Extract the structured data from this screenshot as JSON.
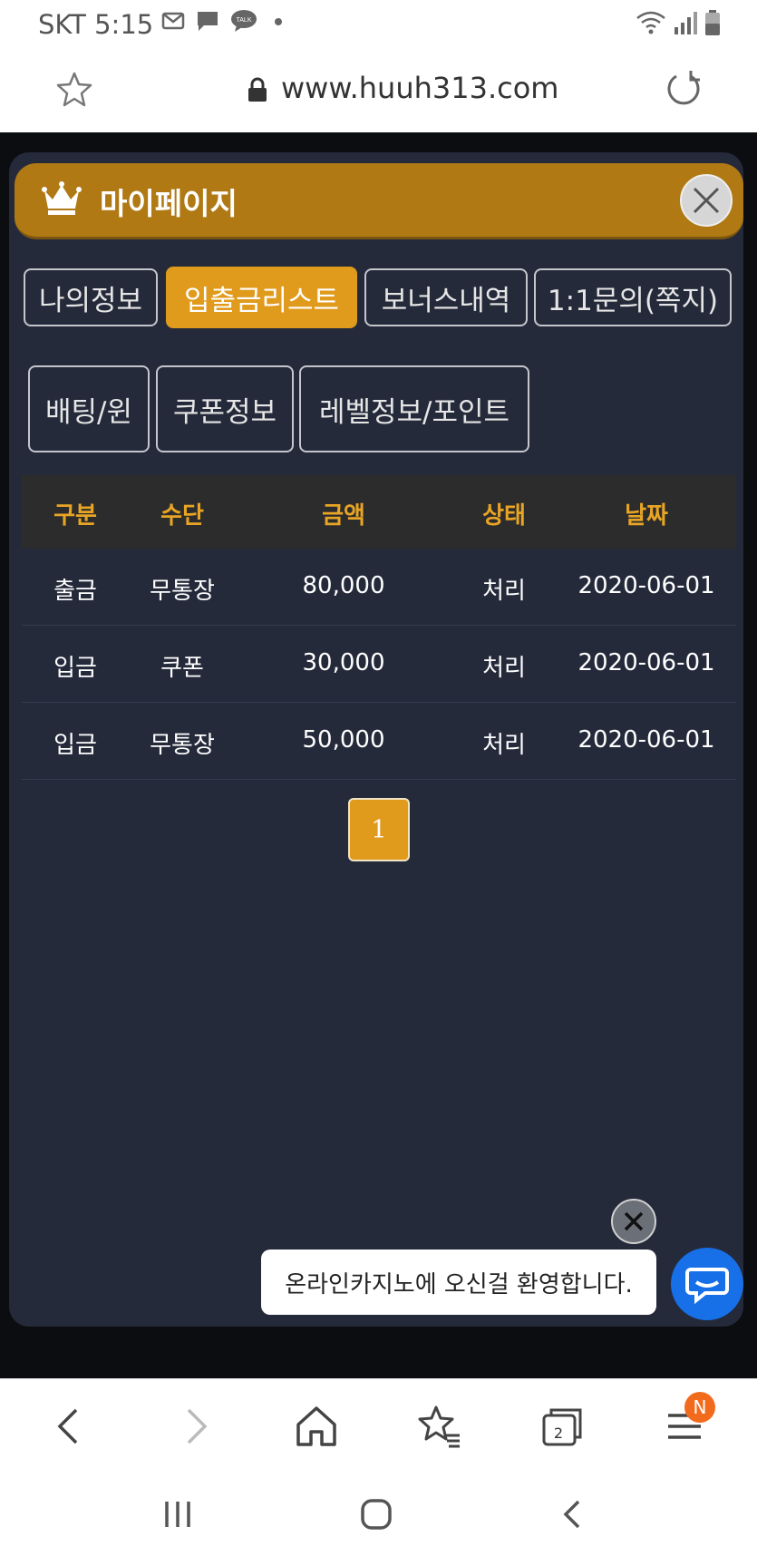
{
  "status_bar": {
    "carrier_time": "SKT 5:15",
    "icons": [
      "gmail-icon",
      "message-icon",
      "kakaotalk-icon",
      "dot-icon",
      "wifi-icon",
      "signal-icon",
      "battery-icon"
    ]
  },
  "address_bar": {
    "url": "www.huuh313.com"
  },
  "modal": {
    "title": "마이페이지",
    "tabs_row1": [
      "나의정보",
      "입출금리스트",
      "보너스내역",
      "1:1문의(쪽지)"
    ],
    "tabs_row2": [
      "배팅/윈",
      "쿠폰정보",
      "레벨정보/포인트"
    ],
    "active_tab": "입출금리스트",
    "table": {
      "headers": [
        "구분",
        "수단",
        "금액",
        "상태",
        "날짜"
      ],
      "rows": [
        [
          "출금",
          "무통장",
          "80,000",
          "처리",
          "2020-06-01"
        ],
        [
          "입금",
          "쿠폰",
          "30,000",
          "처리",
          "2020-06-01"
        ],
        [
          "입금",
          "무통장",
          "50,000",
          "처리",
          "2020-06-01"
        ]
      ]
    },
    "pagination": {
      "current": "1"
    }
  },
  "chat": {
    "welcome": "온라인카지노에 오신걸 환영합니다."
  },
  "browser_bar": {
    "tab_count": "2",
    "menu_badge": "N"
  },
  "colors": {
    "header_gold": "#b07914",
    "accent_orange": "#e09a1c",
    "modal_bg": "#252a3b",
    "table_head_text": "#e8a525",
    "chat_blue": "#1770e8"
  }
}
